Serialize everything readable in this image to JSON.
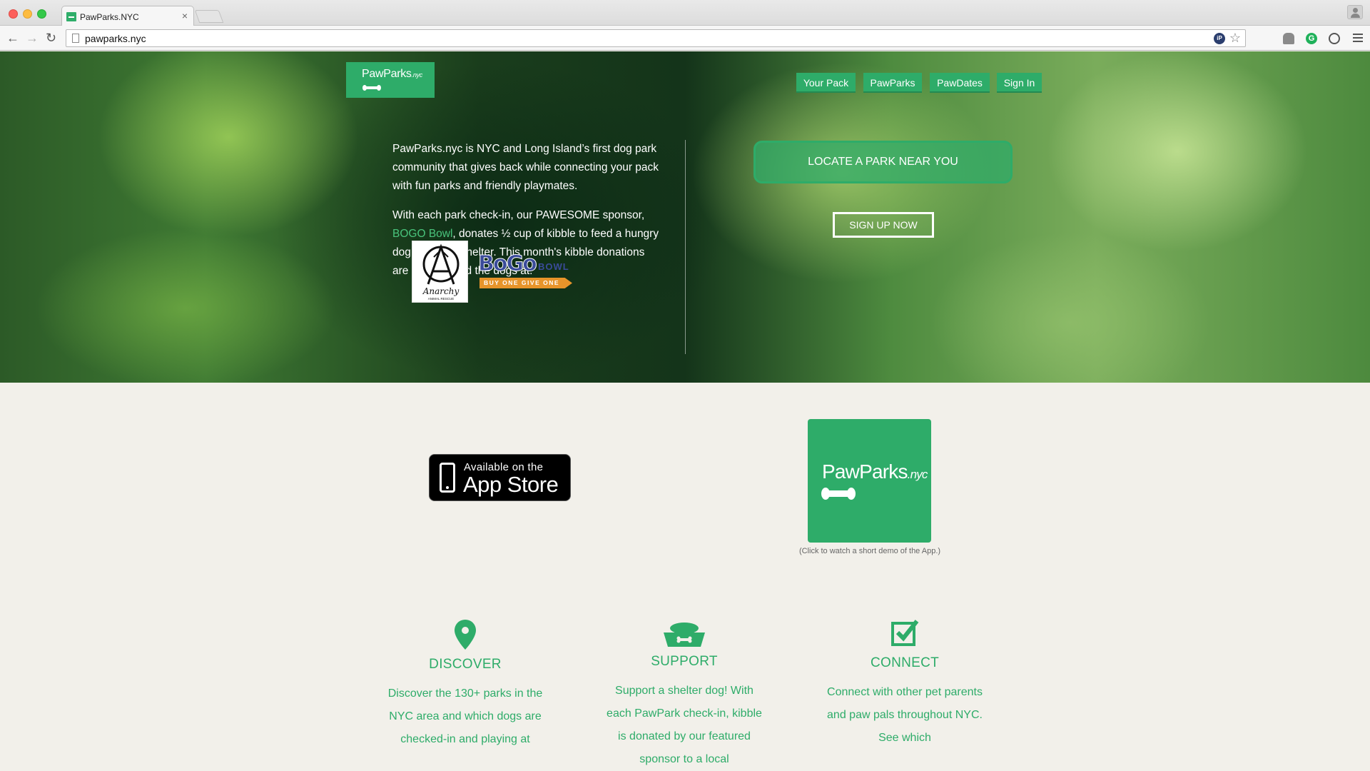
{
  "browser": {
    "tab_title": "PawParks.NYC",
    "url": "pawparks.nyc"
  },
  "hero": {
    "logo": {
      "name": "PawParks",
      "suffix": ".nyc"
    },
    "nav": [
      "Your Pack",
      "PawParks",
      "PawDates",
      "Sign In"
    ],
    "intro": "PawParks.nyc is NYC and Long Island’s first dog park community that gives back while connecting your pack with fun parks and friendly playmates.",
    "sponsor_before": "With each park check-in, our PAWESOME sponsor, ",
    "sponsor_link": "BOGO Bowl",
    "sponsor_after": ", donates ½ cup of kibble to feed a hungry dog in a local shelter. This month's kibble donations are helping feed the dogs at:",
    "rescue_logo_text": "Anarchy",
    "rescue_logo_subtext": "ANIMAL RESCUE",
    "bogo_logo": {
      "letters": "BoGo",
      "word": "BOWL",
      "ribbon": "BUY ONE GIVE ONE"
    },
    "locate_button": "LOCATE A PARK NEAR YOU",
    "signup_button": "SIGN UP NOW"
  },
  "app": {
    "badge_line1": "Available on the",
    "badge_line2": "App Store",
    "tile_name": "PawParks",
    "tile_suffix": ".nyc",
    "caption": "(Click to watch a short demo of the App.)"
  },
  "features": [
    {
      "icon": "map-pin-icon",
      "title": "DISCOVER",
      "text": "Discover the 130+ parks in the NYC area and which dogs are checked-in and playing at"
    },
    {
      "icon": "dog-bowl-icon",
      "title": "SUPPORT",
      "text": "Support a shelter dog! With each PawPark check-in, kibble is donated by our featured sponsor to a local"
    },
    {
      "icon": "checkbox-icon",
      "title": "CONNECT",
      "text": "Connect with other pet parents and paw pals throughout NYC. See which"
    }
  ],
  "colors": {
    "brand_green": "#2eac69",
    "link_green": "#49c47c",
    "background": "#f2f0ea"
  }
}
